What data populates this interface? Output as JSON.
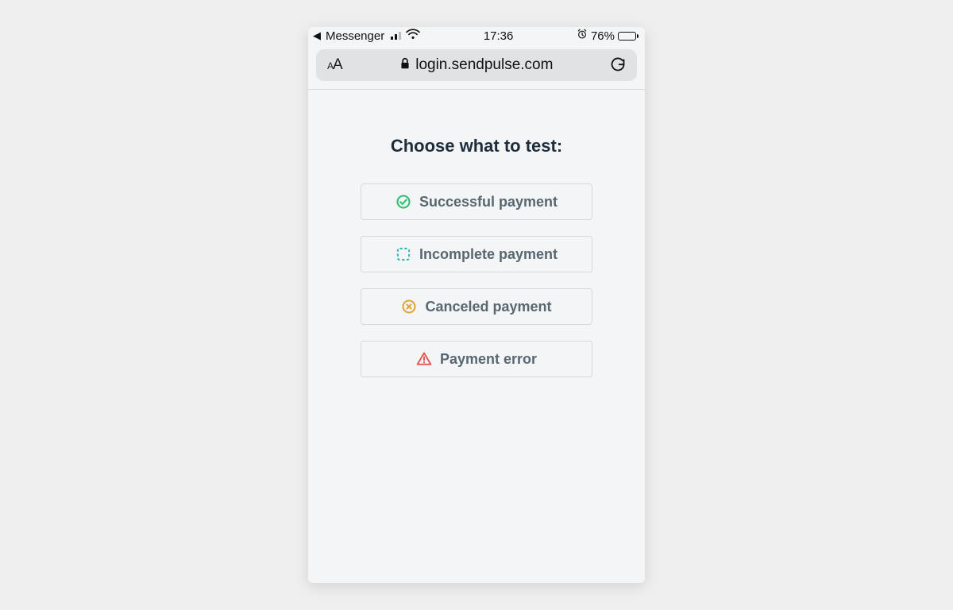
{
  "statusBar": {
    "backApp": "Messenger",
    "time": "17:36",
    "batteryPercent": "76%"
  },
  "address": {
    "url": "login.sendpulse.com"
  },
  "page": {
    "heading": "Choose what to test:",
    "options": {
      "successful": "Successful payment",
      "incomplete": "Incomplete payment",
      "canceled": "Canceled payment",
      "error": "Payment error"
    }
  }
}
